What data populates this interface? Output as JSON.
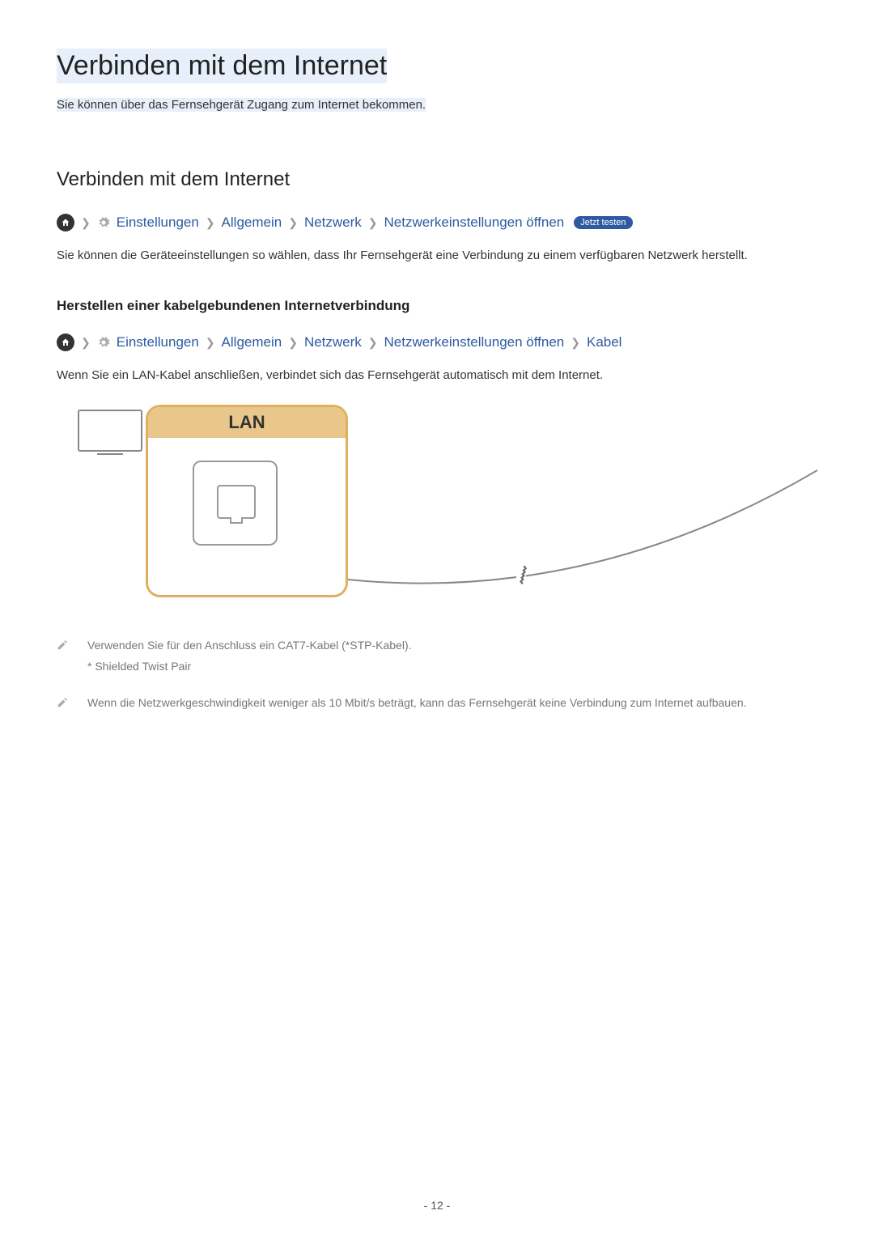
{
  "page": {
    "title": "Verbinden mit dem Internet",
    "subtitle": "Sie können über das Fernsehgerät Zugang zum Internet bekommen.",
    "number": "- 12 -"
  },
  "section1": {
    "heading": "Verbinden mit dem Internet",
    "breadcrumb": {
      "settings": "Einstellungen",
      "general": "Allgemein",
      "network": "Netzwerk",
      "open_network": "Netzwerkeinstellungen öffnen",
      "badge": "Jetzt testen"
    },
    "body": "Sie können die Geräteeinstellungen so wählen, dass Ihr Fernsehgerät eine Verbindung zu einem verfügbaren Netzwerk herstellt."
  },
  "section2": {
    "heading": "Herstellen einer kabelgebundenen Internetverbindung",
    "breadcrumb": {
      "settings": "Einstellungen",
      "general": "Allgemein",
      "network": "Netzwerk",
      "open_network": "Netzwerkeinstellungen öffnen",
      "cable": "Kabel"
    },
    "body": "Wenn Sie ein LAN-Kabel anschließen, verbindet sich das Fernsehgerät automatisch mit dem Internet.",
    "lan_label": "LAN"
  },
  "notes": {
    "n1_line1": "Verwenden Sie für den Anschluss ein CAT7-Kabel (*STP-Kabel).",
    "n1_line2": "* Shielded Twist Pair",
    "n2": "Wenn die Netzwerkgeschwindigkeit weniger als 10 Mbit/s beträgt, kann das Fernsehgerät keine Verbindung zum Internet aufbauen."
  }
}
